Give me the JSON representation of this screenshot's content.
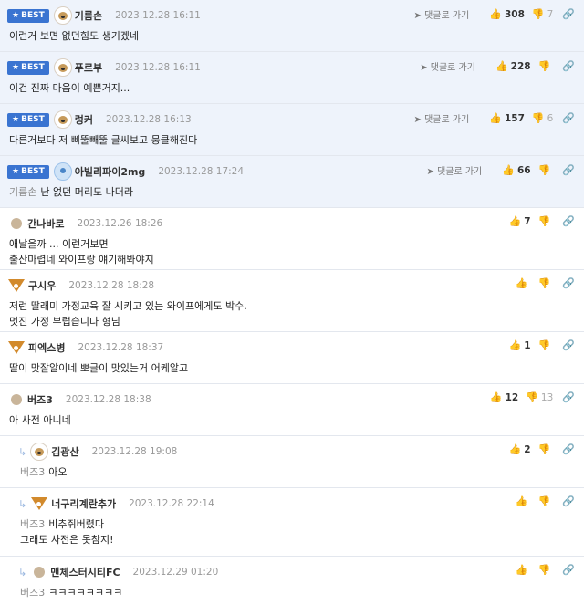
{
  "best_label": "BEST",
  "goto_label": "댓글로 가기",
  "best_comments": [
    {
      "nick": "기름손",
      "date": "2023.12.28 16:11",
      "likes": "308",
      "dislikes": "7",
      "text": "이런거 보면 없던힘도 생기겠네",
      "mention": ""
    },
    {
      "nick": "푸르부",
      "date": "2023.12.28 16:11",
      "likes": "228",
      "dislikes": "",
      "text": "이건 진짜 마음이 예쁜거지...",
      "mention": ""
    },
    {
      "nick": "렁커",
      "date": "2023.12.28 16:13",
      "likes": "157",
      "dislikes": "6",
      "text": "다른거보다 저 삐뚤빼뚤 글씨보고 뭉클해진다",
      "mention": ""
    },
    {
      "nick": "아빌리파이2mg",
      "date": "2023.12.28 17:24",
      "likes": "66",
      "dislikes": "",
      "text": "난 없던 머리도 나더라",
      "mention": "기름손"
    }
  ],
  "comments": [
    {
      "nick": "간나바로",
      "date": "2023.12.26 18:26",
      "likes": "7",
      "dislikes": "",
      "lines": [
        "애날을까 ... 이런거보면",
        "출산마렵네 와이프랑 얘기해봐야지"
      ],
      "mention": ""
    },
    {
      "nick": "구시우",
      "date": "2023.12.28 18:28",
      "likes": "",
      "dislikes": "",
      "lines": [
        "저런 딸래미 가정교육 잘 시키고 있는 와이프에게도 박수.",
        "멋진 가정 부럽습니다 형님"
      ],
      "mention": ""
    },
    {
      "nick": "피엑스병",
      "date": "2023.12.28 18:37",
      "likes": "1",
      "dislikes": "",
      "lines": [
        "딸이 맛잘알이네 뽀글이 맛있는거 어케알고"
      ],
      "mention": ""
    },
    {
      "nick": "버즈3",
      "date": "2023.12.28 18:38",
      "likes": "12",
      "dislikes": "13",
      "lines": [
        "아 사전 아니네"
      ],
      "mention": ""
    }
  ],
  "replies": [
    {
      "nick": "김광산",
      "date": "2023.12.28 19:08",
      "likes": "2",
      "dislikes": "",
      "lines": [
        "아오"
      ],
      "mention": "버즈3"
    },
    {
      "nick": "너구리계란추가",
      "date": "2023.12.28 22:14",
      "likes": "",
      "dislikes": "",
      "lines": [
        "비추줘버렸다",
        "그래도 사전은 못참지!"
      ],
      "mention": "버즈3"
    },
    {
      "nick": "맨체스터시티FC",
      "date": "2023.12.29 01:20",
      "likes": "",
      "dislikes": "",
      "lines": [
        "ㅋㅋㅋㅋㅋㅋㅋㅋ"
      ],
      "mention": "버즈3"
    }
  ]
}
